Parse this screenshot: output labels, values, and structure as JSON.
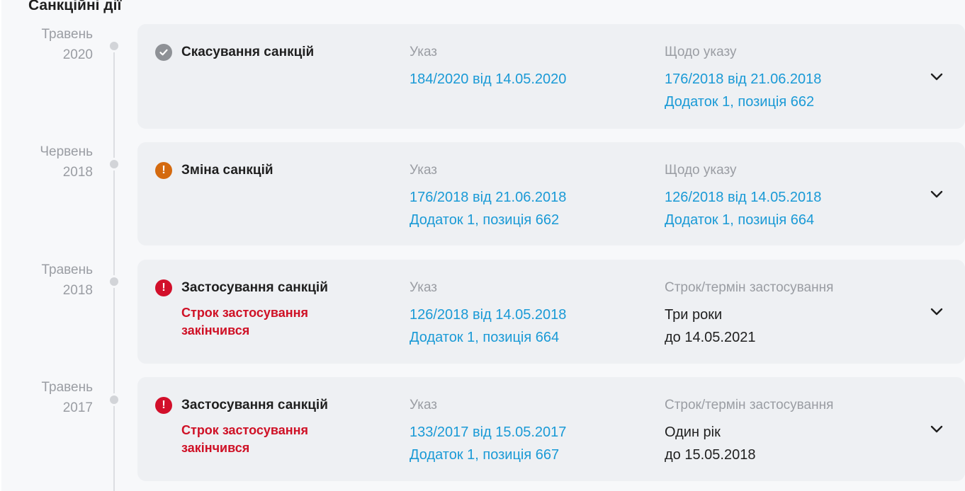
{
  "section_title": "Санкційні дії",
  "colors": {
    "link": "#1a9ad6",
    "expired": "#cf1126",
    "icon_check": "#8e9196",
    "icon_warn": "#d46a0f",
    "icon_error": "#d20f2a"
  },
  "entries": [
    {
      "date_month": "Травень",
      "date_year": "2020",
      "status_icon": "check-circle-icon",
      "action": "Скасування санкцій",
      "expired_note": "",
      "decree_label": "Указ",
      "decree_line1": "184/2020 від 14.05.2020",
      "decree_line2": "",
      "ref_label": "Щодо указу",
      "ref_line1": "176/2018 від 21.06.2018",
      "ref_line2": "Додаток 1, позиція 662"
    },
    {
      "date_month": "Червень",
      "date_year": "2018",
      "status_icon": "warning-circle-icon",
      "action": "Зміна санкцій",
      "expired_note": "",
      "decree_label": "Указ",
      "decree_line1": "176/2018 від 21.06.2018",
      "decree_line2": "Додаток 1, позиція 662",
      "ref_label": "Щодо указу",
      "ref_line1": "126/2018 від 14.05.2018",
      "ref_line2": "Додаток 1, позиція 664"
    },
    {
      "date_month": "Травень",
      "date_year": "2018",
      "status_icon": "error-circle-icon",
      "action": "Застосування санкцій",
      "expired_note": "Строк застосування закінчився",
      "decree_label": "Указ",
      "decree_line1": "126/2018 від 14.05.2018",
      "decree_line2": "Додаток 1, позиція 664",
      "ref_label": "Строк/термін застосування",
      "ref_line1": "Три роки",
      "ref_line2": "до 14.05.2021"
    },
    {
      "date_month": "Травень",
      "date_year": "2017",
      "status_icon": "error-circle-icon",
      "action": "Застосування санкцій",
      "expired_note": "Строк застосування закінчився",
      "decree_label": "Указ",
      "decree_line1": "133/2017 від 15.05.2017",
      "decree_line2": "Додаток 1, позиція 667",
      "ref_label": "Строк/термін застосування",
      "ref_line1": "Один рік",
      "ref_line2": "до 15.05.2018"
    }
  ]
}
